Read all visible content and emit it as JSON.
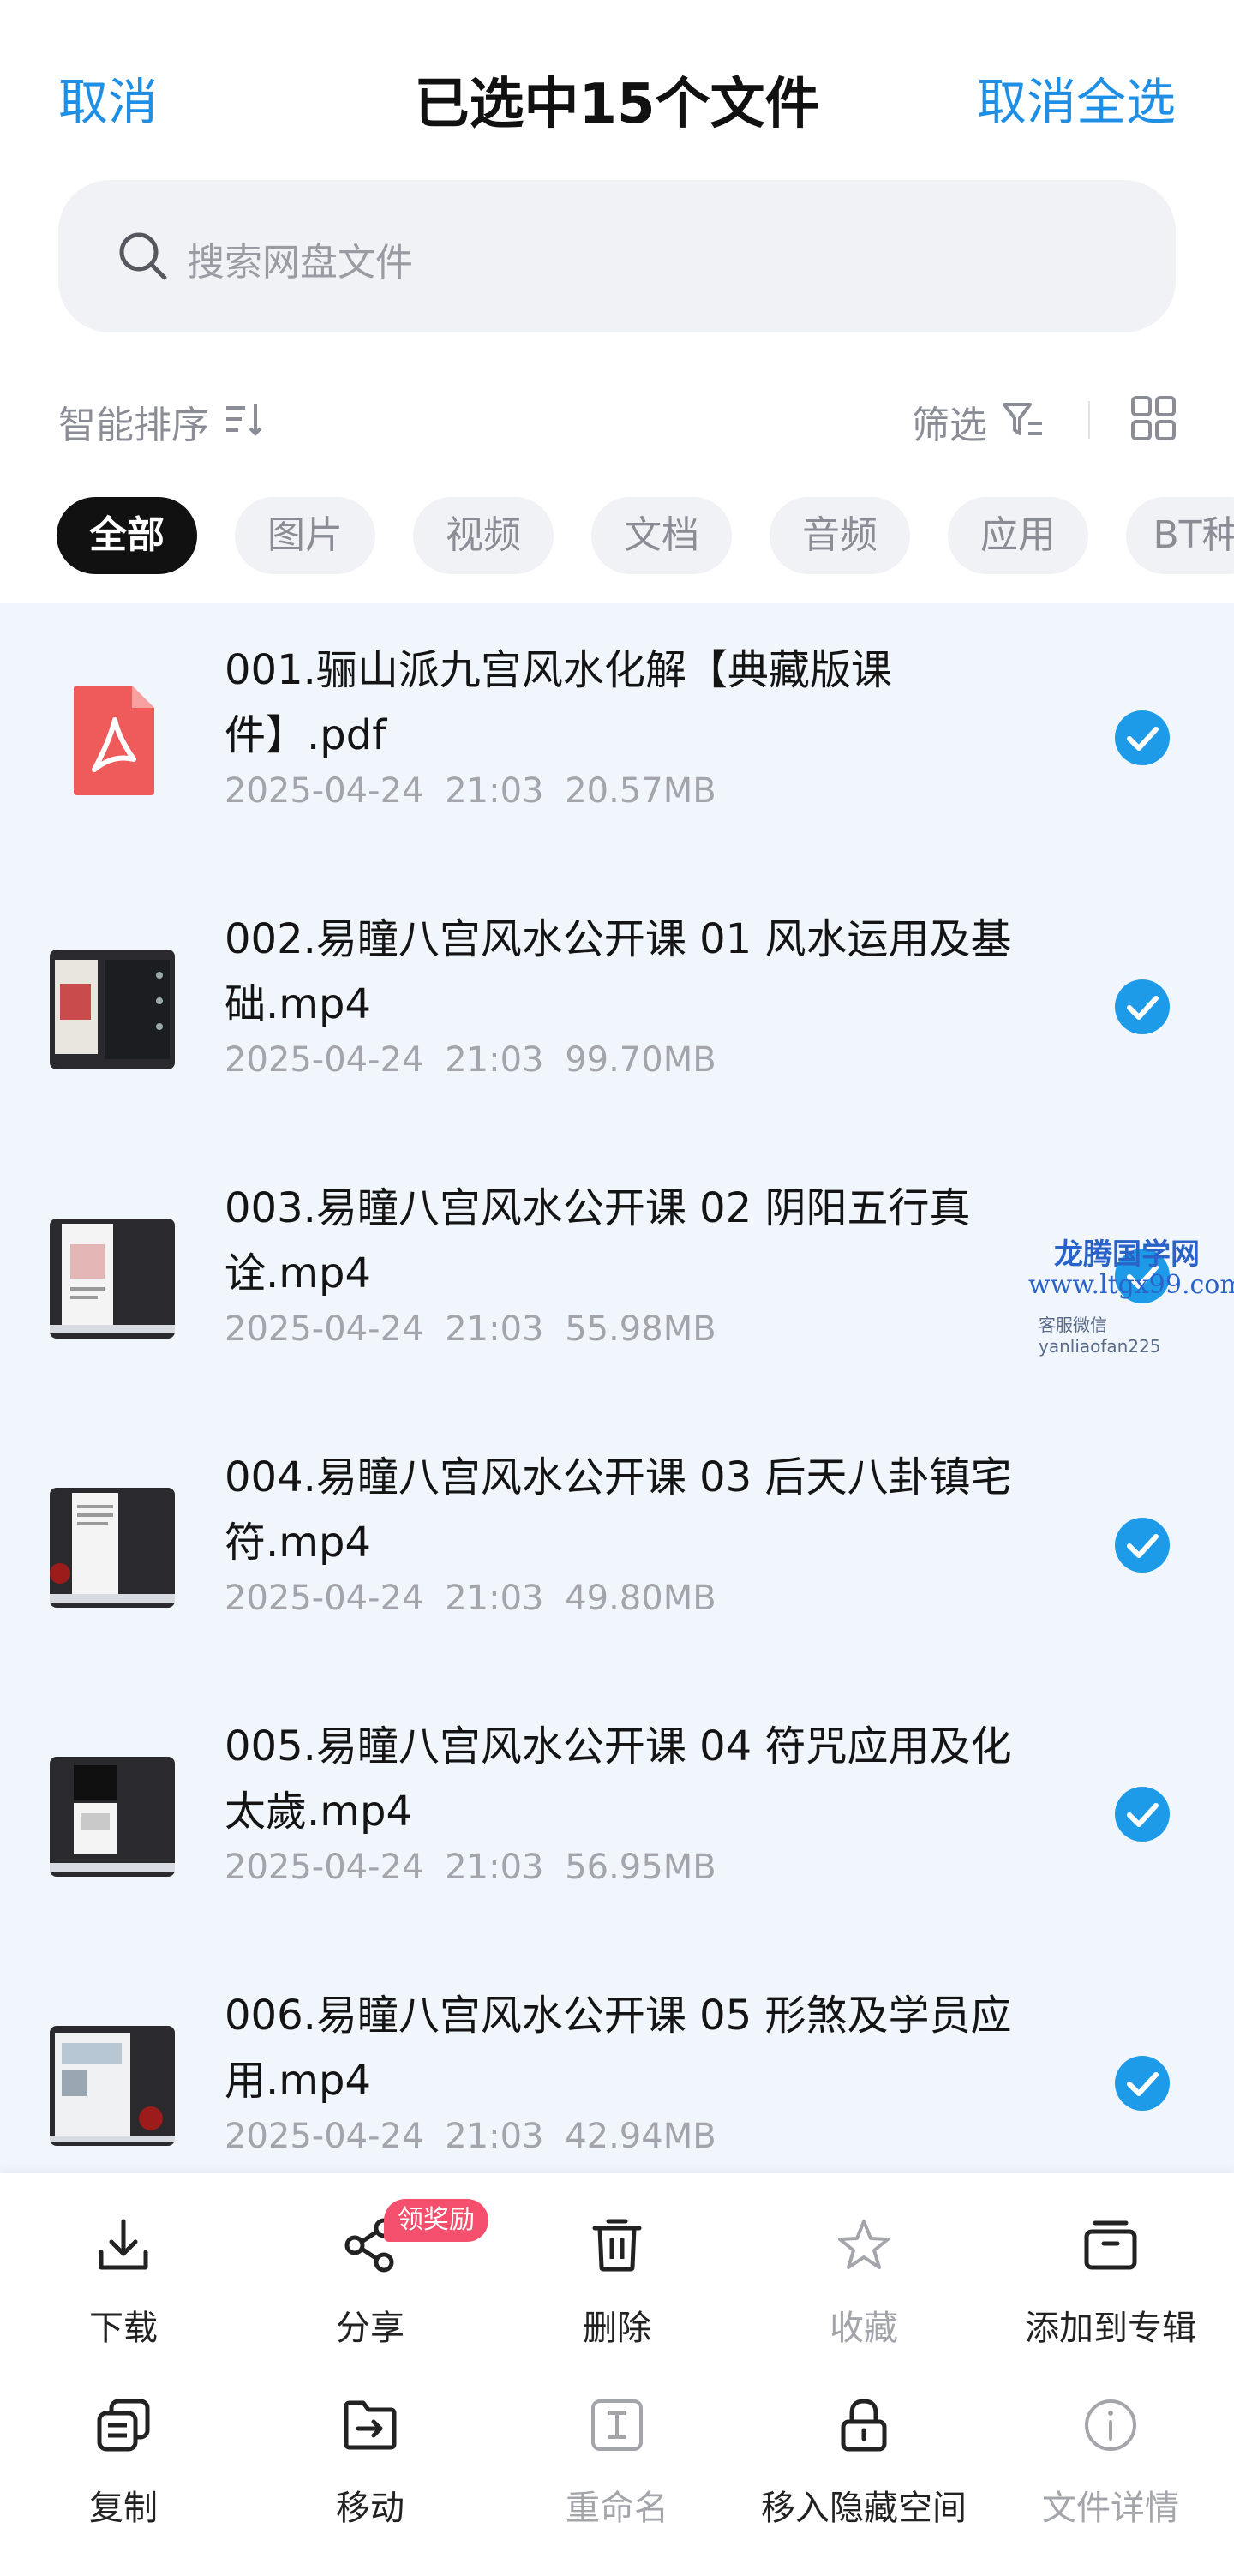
{
  "header": {
    "cancel": "取消",
    "title": "已选中15个文件",
    "select_all_cancel": "取消全选"
  },
  "search": {
    "placeholder": "搜索网盘文件"
  },
  "sortbar": {
    "sort_label": "智能排序",
    "filter_label": "筛选"
  },
  "tabs": [
    {
      "label": "全部",
      "active": true
    },
    {
      "label": "图片",
      "active": false
    },
    {
      "label": "视频",
      "active": false
    },
    {
      "label": "文档",
      "active": false
    },
    {
      "label": "音频",
      "active": false
    },
    {
      "label": "应用",
      "active": false
    },
    {
      "label": "BT种",
      "active": false
    }
  ],
  "files": [
    {
      "name": "001.骊山派九宫风水化解【典藏版课件】.pdf",
      "date": "2025-04-24",
      "time": "21:03",
      "size": "20.57MB",
      "type": "pdf",
      "selected": true
    },
    {
      "name": "002.易瞳八宫风水公开课 01 风水运用及基础.mp4",
      "date": "2025-04-24",
      "time": "21:03",
      "size": "99.70MB",
      "type": "video",
      "selected": true
    },
    {
      "name": "003.易瞳八宫风水公开课 02 阴阳五行真诠.mp4",
      "date": "2025-04-24",
      "time": "21:03",
      "size": "55.98MB",
      "type": "video",
      "selected": true
    },
    {
      "name": "004.易瞳八宫风水公开课 03 后天八卦镇宅符.mp4",
      "date": "2025-04-24",
      "time": "21:03",
      "size": "49.80MB",
      "type": "video",
      "selected": true
    },
    {
      "name": "005.易瞳八宫风水公开课 04 符咒应用及化太歲.mp4",
      "date": "2025-04-24",
      "time": "21:03",
      "size": "56.95MB",
      "type": "video",
      "selected": true
    },
    {
      "name": "006.易瞳八宫风水公开课 05 形煞及学员应用.mp4",
      "date": "2025-04-24",
      "time": "21:03",
      "size": "42.94MB",
      "type": "video",
      "selected": true
    }
  ],
  "watermark": {
    "site": "龙腾国学网",
    "url": "www.ltgx99.com",
    "contact": "客服微信 yanliaofan225"
  },
  "actions": [
    {
      "label": "下载",
      "icon": "download-icon",
      "enabled": true
    },
    {
      "label": "分享",
      "icon": "share-icon",
      "enabled": true,
      "badge": "领奖励"
    },
    {
      "label": "删除",
      "icon": "trash-icon",
      "enabled": true
    },
    {
      "label": "收藏",
      "icon": "star-icon",
      "enabled": false
    },
    {
      "label": "添加到专辑",
      "icon": "album-icon",
      "enabled": true
    },
    {
      "label": "复制",
      "icon": "copy-icon",
      "enabled": true
    },
    {
      "label": "移动",
      "icon": "move-folder-icon",
      "enabled": true
    },
    {
      "label": "重命名",
      "icon": "rename-icon",
      "enabled": false
    },
    {
      "label": "移入隐藏空间",
      "icon": "lock-icon",
      "enabled": true
    },
    {
      "label": "文件详情",
      "icon": "info-icon",
      "enabled": false
    }
  ],
  "colors": {
    "accent": "#1f8fe6",
    "check": "#1e9be8",
    "badge": "#f4506e",
    "list_bg": "#f1f6fc"
  }
}
